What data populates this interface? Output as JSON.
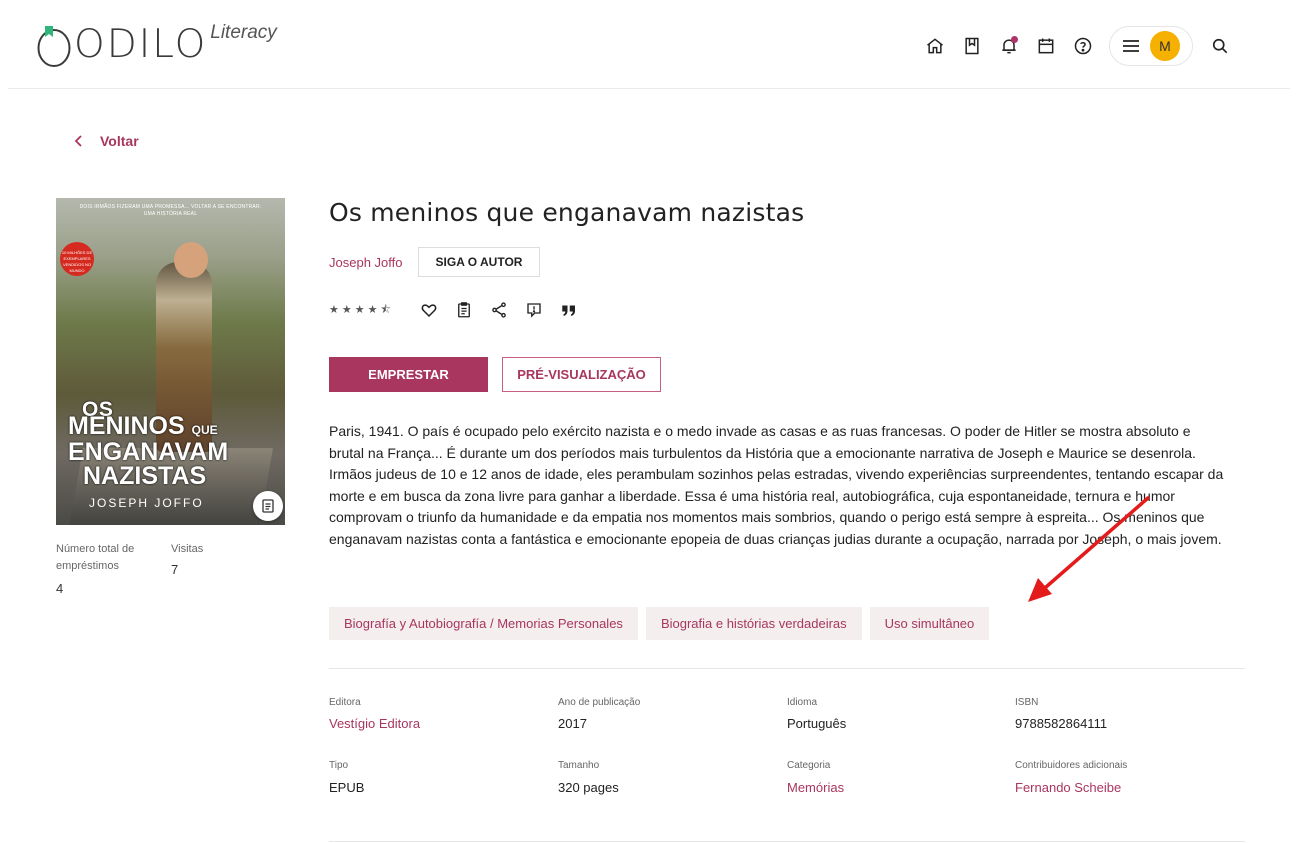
{
  "header": {
    "logo_word": "ODILO",
    "logo_sub": "Literacy",
    "avatar_initial": "M",
    "icons": [
      "home-icon",
      "bookmark-icon",
      "bell-icon",
      "calendar-icon",
      "help-icon",
      "menu-icon",
      "search-icon"
    ],
    "accent_color": "#a8365f",
    "avatar_color": "#f5b000"
  },
  "back": {
    "label": "Voltar"
  },
  "cover": {
    "tagline_line1": "DOIS IRMÃOS FIZERAM UMA PROMESSA... VOLTAR A SE ENCONTRAR.",
    "tagline_line2": "UMA HISTÓRIA REAL",
    "badge": "10 MILHÕES DE EXEMPLARES VENDIDOS NO MUNDO",
    "title_l1": "OS",
    "title_l2": "MENINOS",
    "title_que": "QUE",
    "title_l3": "ENGANAVAM",
    "title_l4": "NAZISTAS",
    "author": "JOSEPH JOFFO"
  },
  "stats": {
    "loans_label": "Número total de empréstimos",
    "loans_value": "4",
    "visits_label": "Visitas",
    "visits_value": "7"
  },
  "book": {
    "title": "Os meninos que enganavam nazistas",
    "author": "Joseph Joffo",
    "follow_label": "SIGA O AUTOR",
    "rating": 4.5,
    "stars_text": "★★★★⯪",
    "borrow_label": "EMPRESTAR",
    "preview_label": "PRÉ-VISUALIZAÇÃO",
    "description": "Paris, 1941. O país é ocupado pelo exército nazista e o medo invade as casas e as ruas francesas. O poder de Hitler se mostra absoluto e brutal na França... É durante um dos períodos mais turbulentos da História que a emocionante narrativa de Joseph e Maurice se desenrola. Irmãos judeus de 10 e 12 anos de idade, eles perambulam sozinhos pelas estradas, vivendo experiências surpreendentes, tentando escapar da morte e em busca da zona livre para ganhar a liberdade. Essa é uma história real, autobiográfica, cuja espontaneidade, ternura e humor comprovam o triunfo da humanidade e da empatia nos momentos mais sombrios, quando o perigo está sempre à espreita... Os meninos que enganavam nazistas conta a fantástica e emocionante epopeia de duas crianças judias durante a ocupação, narrada por Joseph, o mais jovem.",
    "tags": [
      "Biografía y Autobiografía / Memorias Personales",
      "Biografia e histórias verdadeiras",
      "Uso simultâneo"
    ]
  },
  "details": {
    "publisher_label": "Editora",
    "publisher_value": "Vestígio Editora",
    "year_label": "Ano de publicação",
    "year_value": "2017",
    "language_label": "Idioma",
    "language_value": "Português",
    "isbn_label": "ISBN",
    "isbn_value": "9788582864111",
    "type_label": "Tipo",
    "type_value": "EPUB",
    "size_label": "Tamanho",
    "size_value": "320 pages",
    "category_label": "Categoria",
    "category_value": "Memórias",
    "contributors_label": "Contribuidores adicionais",
    "contributors_value": "Fernando Scheibe"
  },
  "annotation": {
    "arrow_color": "#e31b1b"
  }
}
